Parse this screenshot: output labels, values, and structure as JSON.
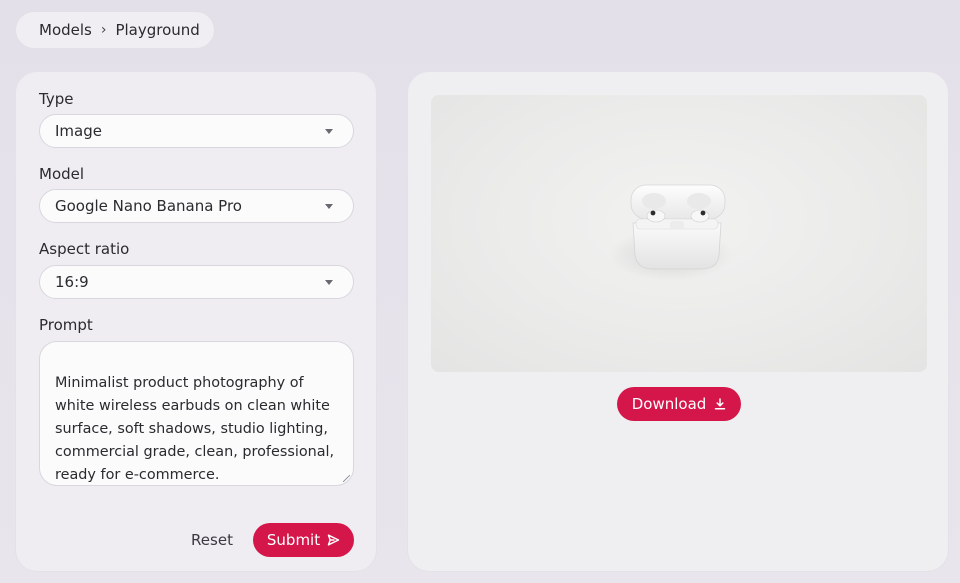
{
  "breadcrumb": {
    "items": [
      "Models",
      "Playground"
    ],
    "separator": "›"
  },
  "form": {
    "type": {
      "label": "Type",
      "value": "Image"
    },
    "model": {
      "label": "Model",
      "value": "Google Nano Banana Pro"
    },
    "aspect_ratio": {
      "label": "Aspect ratio",
      "value": "16:9"
    },
    "prompt": {
      "label": "Prompt",
      "value": "Minimalist product photography of white wireless earbuds on clean white surface, soft shadows, studio lighting, commercial grade, clean, professional, ready for e-commerce."
    },
    "reset_label": "Reset",
    "submit_label": "Submit",
    "submit_icon": "send-icon"
  },
  "result": {
    "image_subject": "white wireless earbuds in open charging case on white surface",
    "download_label": "Download",
    "download_icon": "download-icon"
  },
  "colors": {
    "accent": "#d4164a",
    "background": "#e6e3ea",
    "panel": "#efedf1"
  }
}
